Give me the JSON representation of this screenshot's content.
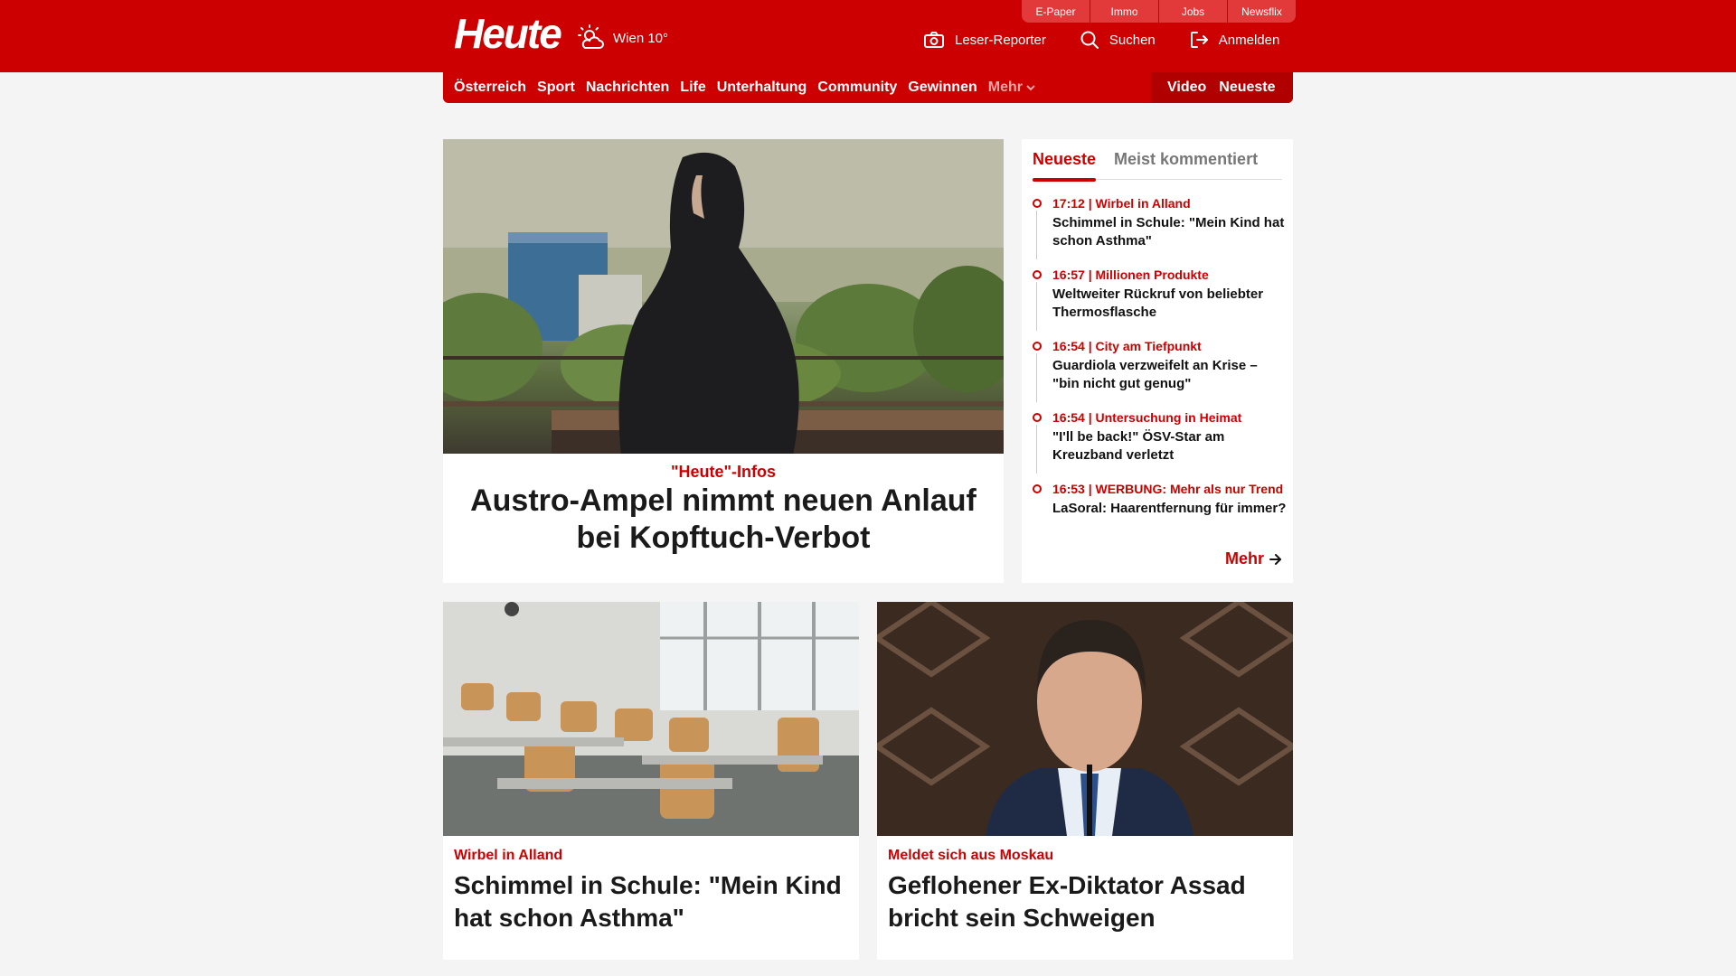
{
  "header": {
    "logo": "Heute",
    "weather": "Wien 10°",
    "util_tabs": [
      "E-Paper",
      "Immo",
      "Jobs",
      "Newsflix"
    ],
    "actions": {
      "reporter": "Leser-Reporter",
      "search": "Suchen",
      "login": "Anmelden"
    }
  },
  "nav": {
    "items": [
      "Österreich",
      "Sport",
      "Nachrichten",
      "Life",
      "Unterhaltung",
      "Community",
      "Gewinnen"
    ],
    "more": "Mehr",
    "right": [
      "Video",
      "Neueste"
    ]
  },
  "hero": {
    "category": "\"Heute\"-Infos",
    "title": "Austro-Ampel nimmt neuen Anlauf bei Kopftuch-Verbot"
  },
  "sidebar": {
    "tabs": [
      "Neueste",
      "Meist kommentiert"
    ],
    "items": [
      {
        "meta": "17:12 | Wirbel in Alland",
        "title": "Schimmel in Schule: \"Mein Kind hat schon Asthma\""
      },
      {
        "meta": "16:57 | Millionen Produkte",
        "title": "Weltweiter Rückruf von beliebter Thermosflasche"
      },
      {
        "meta": "16:54 | City am Tiefpunkt",
        "title": "Guardiola verzweifelt an Krise – \"bin nicht gut genug\""
      },
      {
        "meta": "16:54 | Untersuchung in Heimat",
        "title": "\"I'll be back!\" ÖSV-Star am Kreuzband verletzt"
      },
      {
        "meta": "16:53 | WERBUNG: Mehr als nur Trend",
        "title": "LaSoral: Haarentfernung für immer?"
      }
    ],
    "more": "Mehr"
  },
  "cards": [
    {
      "category": "Wirbel in Alland",
      "title": "Schimmel in Schule: \"Mein Kind hat schon Asthma\""
    },
    {
      "category": "Meldet sich aus Moskau",
      "title": "Geflohener Ex-Diktator Assad bricht sein Schweigen"
    }
  ],
  "colors": {
    "brand": "#cc0000",
    "brand_dark": "#b00000",
    "background": "#f4f4f4"
  }
}
